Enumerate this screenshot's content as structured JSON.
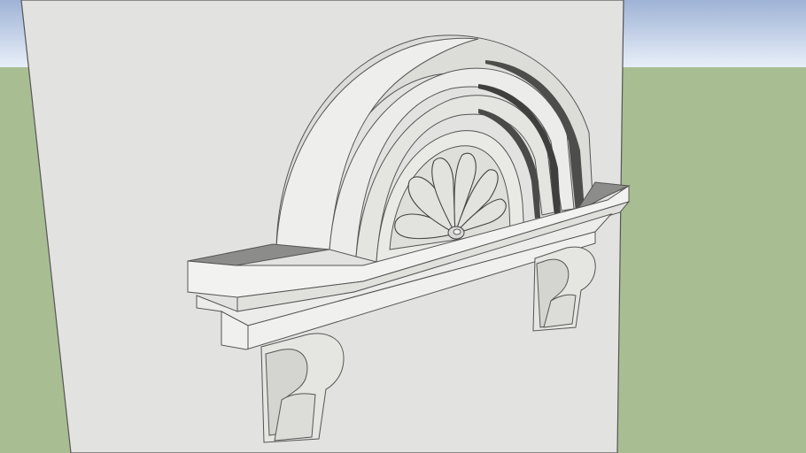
{
  "scene": {
    "description_visible_text": "",
    "colors": {
      "sky_top": "#9fb3d6",
      "sky_bottom": "#e9f0f9",
      "ground": "#a9bd93",
      "wall": "#e2e2e0",
      "face_light": "#f4f4f2",
      "face_mid": "#e6e6e3",
      "face_shadow": "#cfcfcc",
      "top_dark": "#8c8c8a",
      "edge": "#555555"
    }
  }
}
